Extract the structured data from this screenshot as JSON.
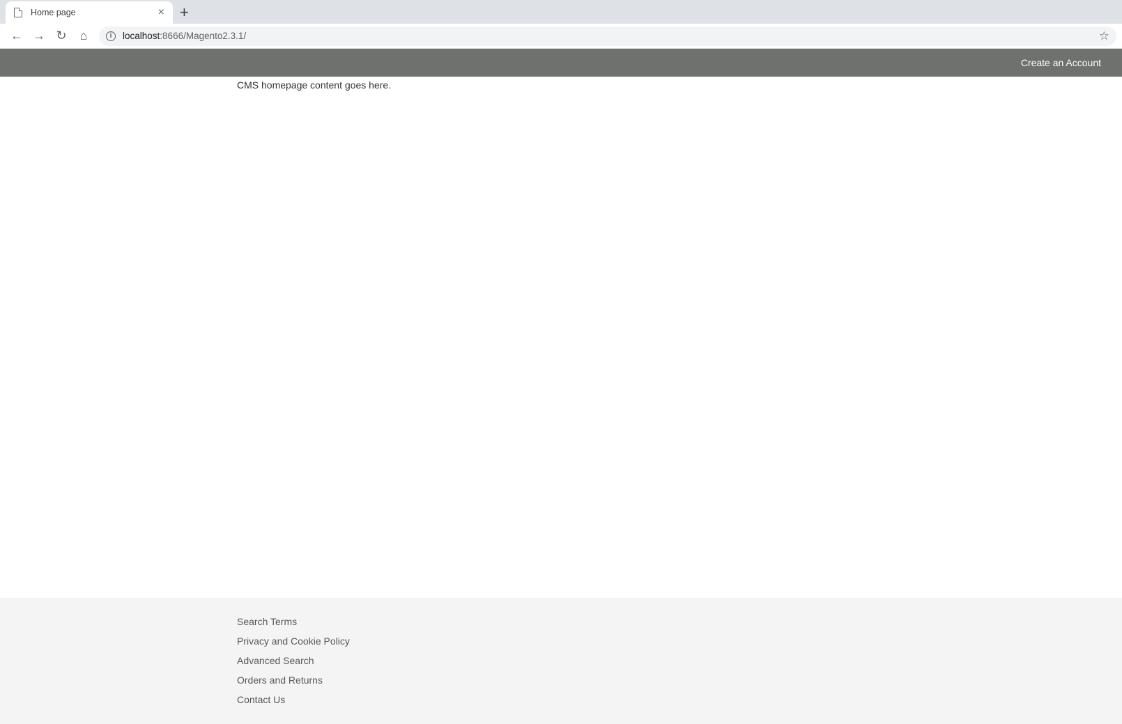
{
  "browser": {
    "tab": {
      "title": "Home page",
      "close_label": "×"
    },
    "new_tab_label": "+",
    "nav": {
      "back": "←",
      "forward": "→",
      "reload": "↻",
      "home": "⌂"
    },
    "url": {
      "host": "localhost",
      "rest": ":8666/Magento2.3.1/"
    },
    "bookmark_icon": "☆",
    "info_icon": "i"
  },
  "header": {
    "create_account_label": "Create an Account"
  },
  "main": {
    "content": "CMS homepage content goes here."
  },
  "footer": {
    "links": [
      "Search Terms",
      "Privacy and Cookie Policy",
      "Advanced Search",
      "Orders and Returns",
      "Contact Us"
    ]
  }
}
